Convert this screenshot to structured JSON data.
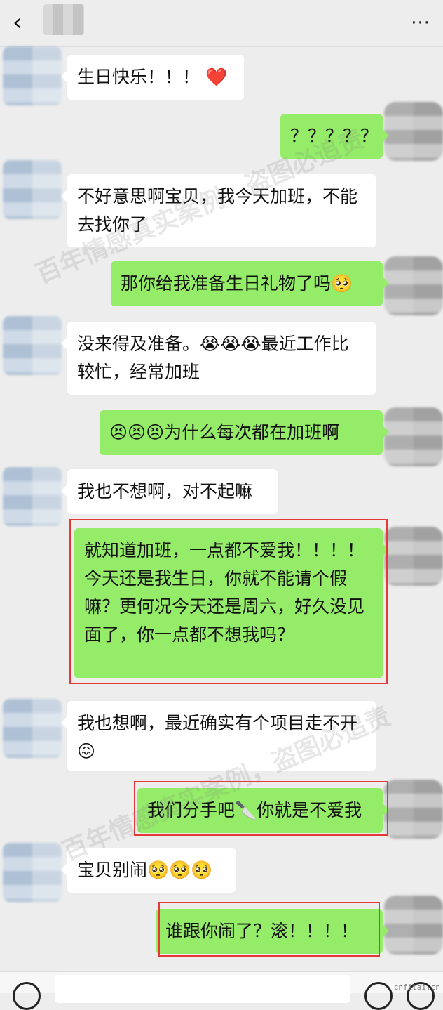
{
  "header": {
    "back_icon": "‹",
    "more_icon": "···"
  },
  "messages": [
    {
      "from": "them",
      "text": "生日快乐！！！ ❤️"
    },
    {
      "from": "me",
      "text": "？？？？？"
    },
    {
      "from": "them",
      "text": "不好意思啊宝贝，我今天加班，不能去找你了"
    },
    {
      "from": "me",
      "text": "那你给我准备生日礼物了吗🥺"
    },
    {
      "from": "them",
      "text": "没来得及准备。😭😭😭最近工作比较忙，经常加班"
    },
    {
      "from": "me",
      "text": "😣😣😣为什么每次都在加班啊"
    },
    {
      "from": "them",
      "text": "我也不想啊，对不起嘛"
    },
    {
      "from": "me",
      "text": "就知道加班，一点都不爱我！！！！今天还是我生日，你就不能请个假嘛？更何况今天还是周六，好久没见面了，你一点都不想我吗？"
    },
    {
      "from": "them",
      "text": "我也想啊，最近确实有个项目走不开😖"
    },
    {
      "from": "me",
      "text": "我们分手吧🔪你就是不爱我"
    },
    {
      "from": "them",
      "text": "宝贝别闹🥺🥺🥺"
    },
    {
      "from": "me",
      "text": "谁跟你闹了？滚！！！！"
    }
  ],
  "watermark": {
    "text": "百年情感真实案例，盗图必追责"
  },
  "footer": {
    "site_tag": "cnfitai.cn"
  },
  "colors": {
    "bg": "#ededed",
    "bubble_me": "#95ec69",
    "bubble_them": "#ffffff",
    "highlight": "#e53935"
  }
}
